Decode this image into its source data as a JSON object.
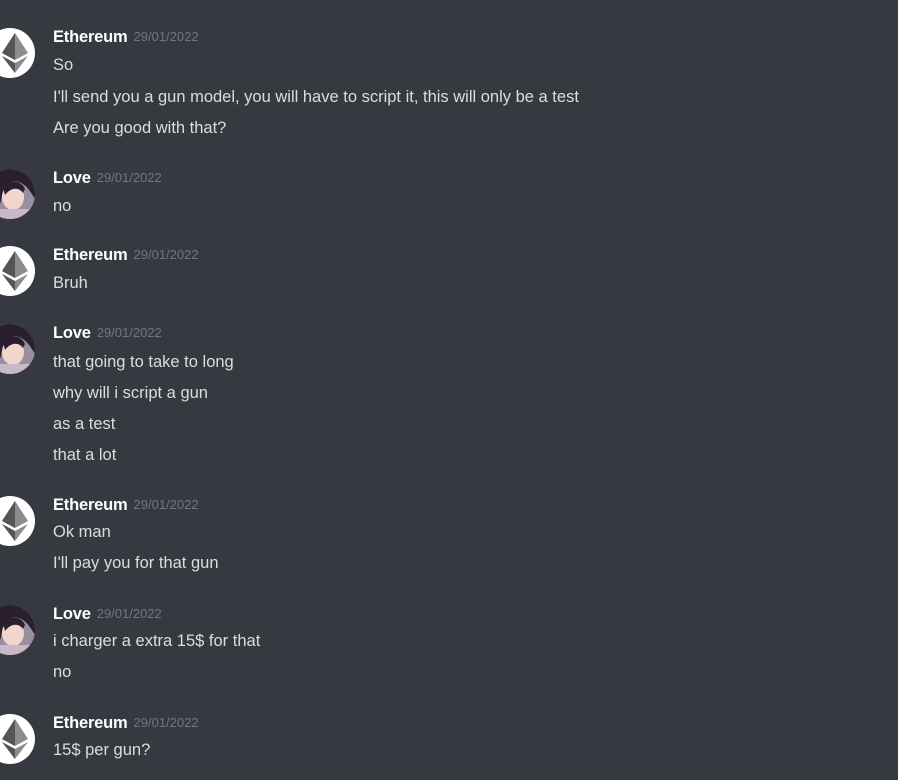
{
  "messages": [
    {
      "author": "Ethereum",
      "avatar": "ethereum-logo-icon",
      "timestamp": "29/01/2022",
      "lines": [
        "So",
        "I'll send you a gun model, you will have to script it, this will only be a test",
        "Are you good with that?"
      ]
    },
    {
      "author": "Love",
      "avatar": "anime-girl-avatar",
      "timestamp": "29/01/2022",
      "lines": [
        "no"
      ]
    },
    {
      "author": "Ethereum",
      "avatar": "ethereum-logo-icon",
      "timestamp": "29/01/2022",
      "lines": [
        "Bruh"
      ]
    },
    {
      "author": "Love",
      "avatar": "anime-girl-avatar",
      "timestamp": "29/01/2022",
      "lines": [
        "that going to take to long",
        "why will i script a gun",
        "as a test",
        "that a lot"
      ]
    },
    {
      "author": "Ethereum",
      "avatar": "ethereum-logo-icon",
      "timestamp": "29/01/2022",
      "lines": [
        "Ok man",
        "I'll pay you for that gun"
      ]
    },
    {
      "author": "Love",
      "avatar": "anime-girl-avatar",
      "timestamp": "29/01/2022",
      "lines": [
        "i charger a extra 15$ for that",
        "no"
      ]
    },
    {
      "author": "Ethereum",
      "avatar": "ethereum-logo-icon",
      "timestamp": "29/01/2022",
      "lines": [
        "15$ per gun?"
      ]
    }
  ],
  "colors": {
    "background": "#36393f",
    "username": "#ffffff",
    "timestamp": "#72767d",
    "text": "#dcddde"
  }
}
